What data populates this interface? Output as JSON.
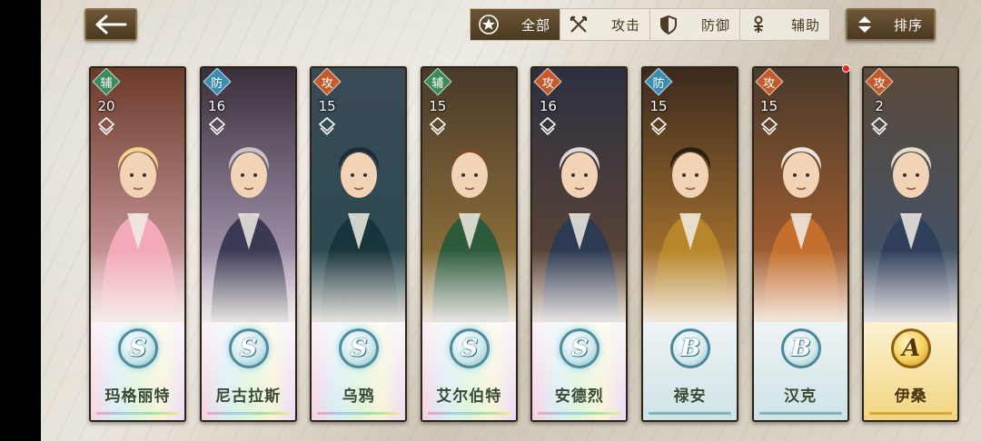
{
  "nav": {
    "back_icon": "arrow-left-icon"
  },
  "filters": [
    {
      "label": "全部",
      "icon": "star-badge-icon",
      "active": true
    },
    {
      "label": "攻击",
      "icon": "crossed-swords-icon",
      "active": false
    },
    {
      "label": "防御",
      "icon": "shield-icon",
      "active": false
    },
    {
      "label": "辅助",
      "icon": "support-staff-icon",
      "active": false
    }
  ],
  "sort": {
    "label": "排序",
    "icon": "sort-arrows-icon"
  },
  "heroes": [
    {
      "name": "玛格丽特",
      "role": "辅",
      "role_type": "sup",
      "level": "20",
      "grade": "S",
      "bg": [
        "#6b3a2a",
        "#e9b6c1"
      ],
      "hair": "#f3d58a",
      "coat": "#f2a9b8"
    },
    {
      "name": "尼古拉斯",
      "role": "防",
      "role_type": "def",
      "level": "16",
      "grade": "S",
      "bg": [
        "#3a2e3c",
        "#c9b9d6"
      ],
      "hair": "#c8c3bf",
      "coat": "#3b3a55"
    },
    {
      "name": "乌鸦",
      "role": "攻",
      "role_type": "atk",
      "level": "15",
      "grade": "S",
      "bg": [
        "#3a4a55",
        "#274a50"
      ],
      "hair": "#1f2a33",
      "coat": "#18353b"
    },
    {
      "name": "艾尔伯特",
      "role": "辅",
      "role_type": "sup",
      "level": "15",
      "grade": "S",
      "bg": [
        "#4a3a2a",
        "#a4823f"
      ],
      "hair": "#7a4a2a",
      "coat": "#2e5a3c"
    },
    {
      "name": "安德烈",
      "role": "攻",
      "role_type": "atk",
      "level": "16",
      "grade": "S",
      "bg": [
        "#2d3040",
        "#6a4a34"
      ],
      "hair": "#dcdad5",
      "coat": "#2c3a52"
    },
    {
      "name": "禄安",
      "role": "防",
      "role_type": "def",
      "level": "15",
      "grade": "B",
      "bg": [
        "#3c2a1e",
        "#c98b34"
      ],
      "hair": "#2a1e14",
      "coat": "#b8862a"
    },
    {
      "name": "汉克",
      "role": "攻",
      "role_type": "atk",
      "level": "15",
      "grade": "B",
      "bg": [
        "#4a3a2a",
        "#c06a32"
      ],
      "hair": "#e8e4de",
      "coat": "#c46f2e"
    },
    {
      "name": "伊桑",
      "role": "攻",
      "role_type": "atk",
      "level": "2",
      "grade": "A",
      "bg": [
        "#5a4a3a",
        "#3b5577"
      ],
      "hair": "#e8dcc6",
      "coat": "#2f3f5c"
    }
  ]
}
